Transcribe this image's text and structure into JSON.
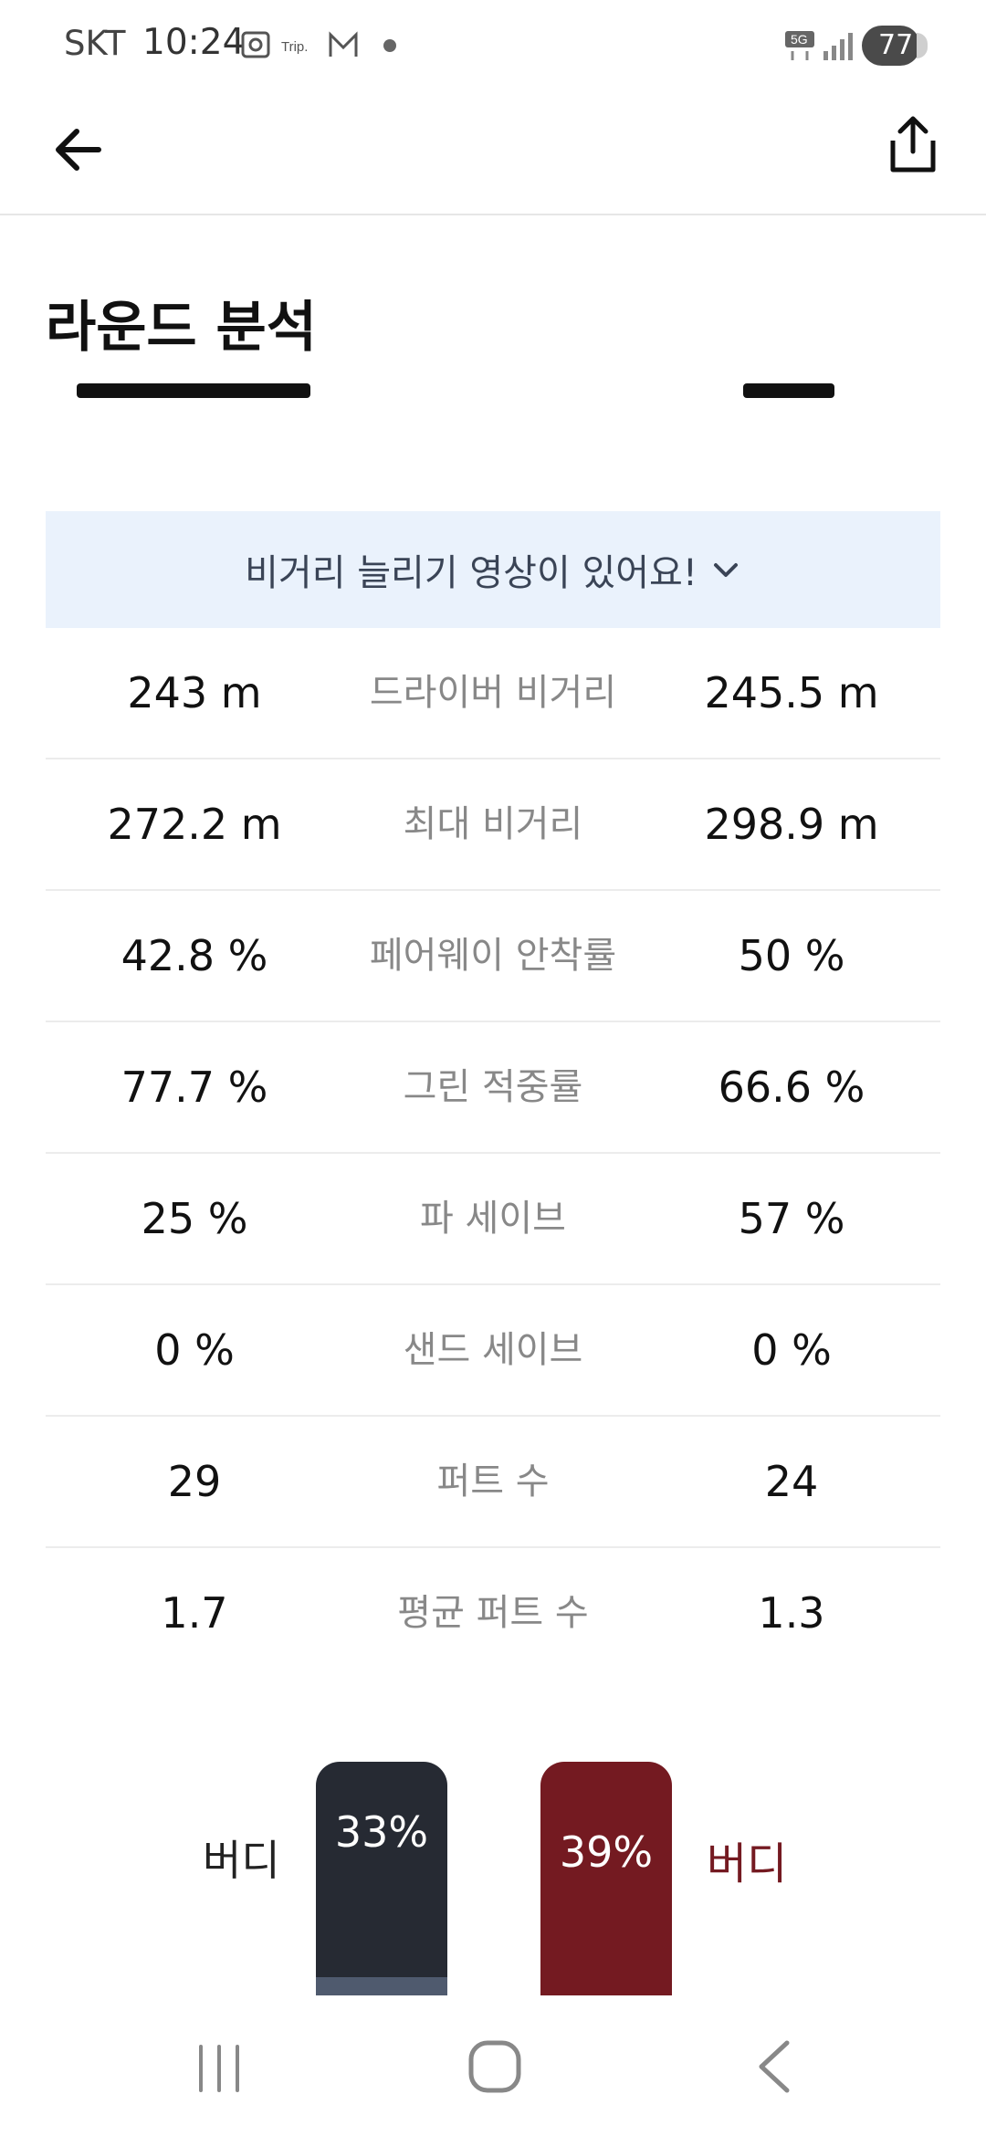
{
  "status_bar": {
    "carrier": "SKT",
    "time": "10:24",
    "notification_icons": [
      "screenshot-icon",
      "trip-icon",
      "gmail-icon",
      "dot-icon"
    ],
    "trip_label": "Trip.",
    "network": "5G",
    "battery": "77"
  },
  "app_bar": {
    "back_icon": "arrow-left-icon",
    "share_icon": "share-icon"
  },
  "page": {
    "title": "라운드 분석"
  },
  "banner": {
    "text": "비거리 늘리기 영상이 있어요!",
    "icon": "chevron-down-icon"
  },
  "stats": [
    {
      "left": "243 m",
      "label": "드라이버 비거리",
      "right": "245.5 m"
    },
    {
      "left": "272.2 m",
      "label": "최대 비거리",
      "right": "298.9 m"
    },
    {
      "left": "42.8 %",
      "label": "페어웨이 안착률",
      "right": "50 %"
    },
    {
      "left": "77.7 %",
      "label": "그린 적중률",
      "right": "66.6 %"
    },
    {
      "left": "25 %",
      "label": "파 세이브",
      "right": "57 %"
    },
    {
      "left": "0 %",
      "label": "샌드 세이브",
      "right": "0 %"
    },
    {
      "left": "29",
      "label": "퍼트 수",
      "right": "24"
    },
    {
      "left": "1.7",
      "label": "평균 퍼트 수",
      "right": "1.3"
    }
  ],
  "bars": {
    "left_label": "버디",
    "left_value": "33%",
    "right_label": "버디",
    "right_value": "39%",
    "colors": {
      "left": "#262a33",
      "right": "#741a21"
    }
  },
  "nav": {
    "icons": [
      "recent-apps-icon",
      "home-icon",
      "back-icon"
    ]
  }
}
